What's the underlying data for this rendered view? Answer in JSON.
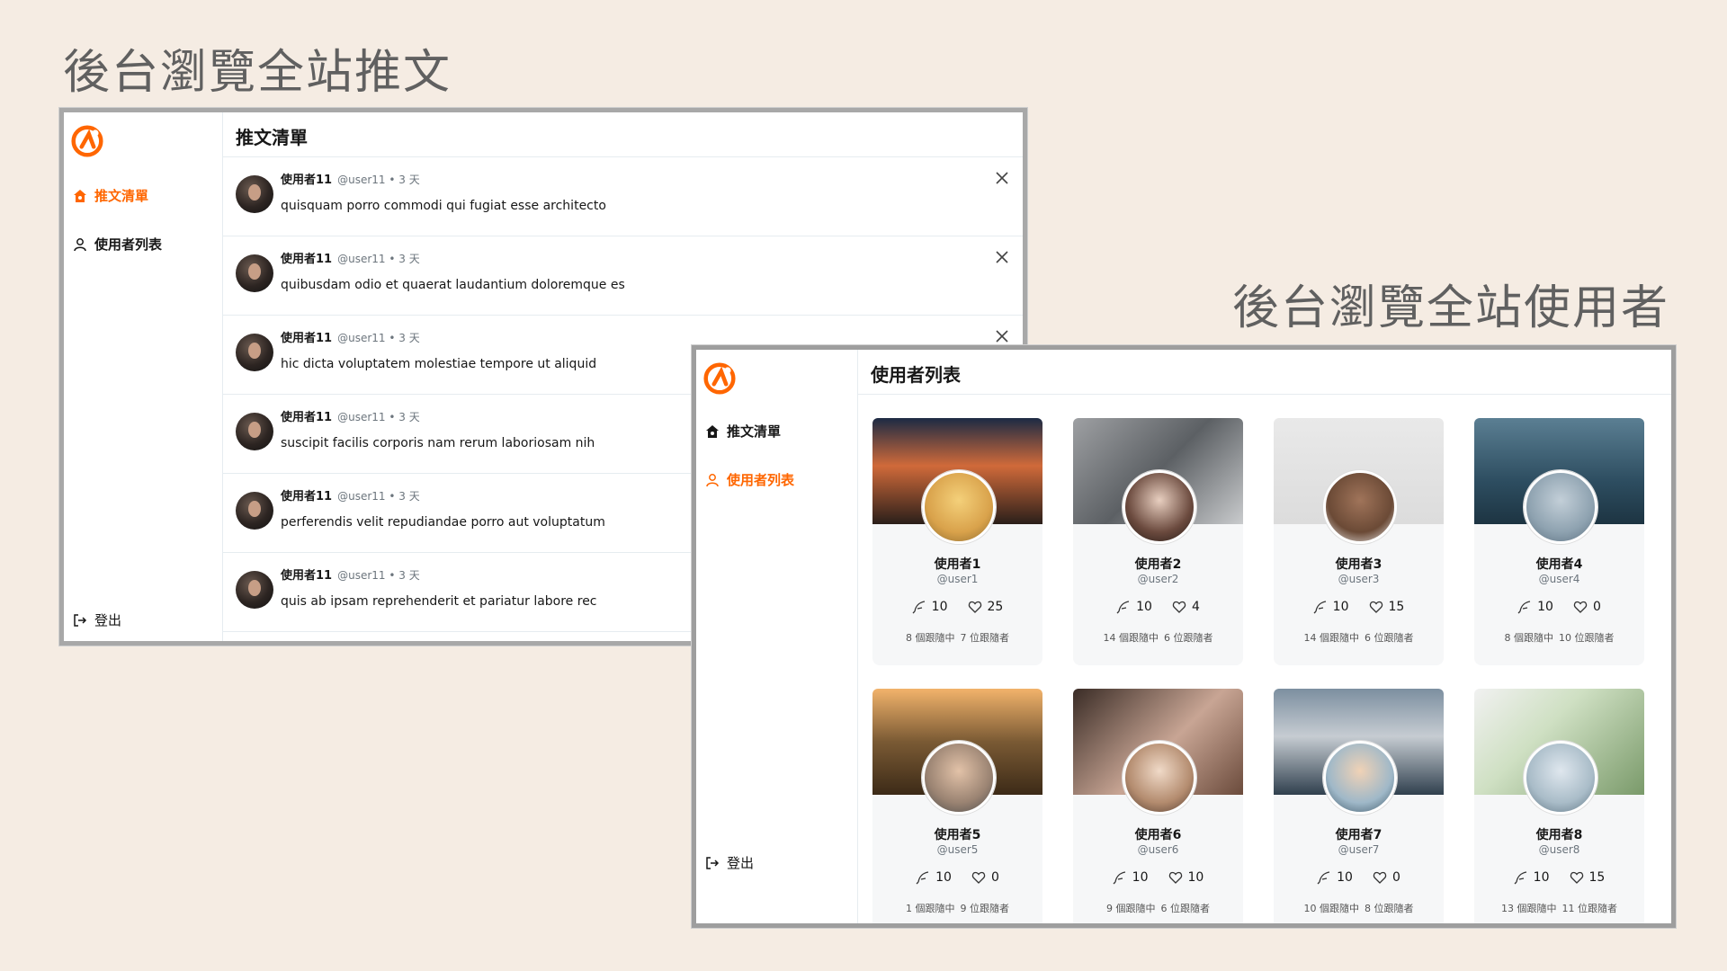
{
  "headings": {
    "tweets_admin": "後台瀏覽全站推文",
    "users_admin": "後台瀏覽全站使用者"
  },
  "colors": {
    "accent": "#ff6600",
    "background": "#f5ece3"
  },
  "nav": {
    "tweets": "推文清單",
    "users": "使用者列表",
    "logout": "登出"
  },
  "tweet_panel": {
    "title": "推文清單",
    "tweets": [
      {
        "name": "使用者11",
        "handle": "@user11",
        "time": "3 天",
        "text": "quisquam porro commodi qui fugiat esse architecto"
      },
      {
        "name": "使用者11",
        "handle": "@user11",
        "time": "3 天",
        "text": "quibusdam odio et quaerat laudantium doloremque es"
      },
      {
        "name": "使用者11",
        "handle": "@user11",
        "time": "3 天",
        "text": "hic dicta voluptatem molestiae tempore ut aliquid"
      },
      {
        "name": "使用者11",
        "handle": "@user11",
        "time": "3 天",
        "text": "suscipit facilis corporis nam rerum laboriosam nih"
      },
      {
        "name": "使用者11",
        "handle": "@user11",
        "time": "3 天",
        "text": "perferendis velit repudiandae porro aut voluptatum"
      },
      {
        "name": "使用者11",
        "handle": "@user11",
        "time": "3 天",
        "text": "quis ab ipsam reprehenderit et pariatur labore rec"
      }
    ]
  },
  "user_panel": {
    "title": "使用者列表",
    "users": [
      {
        "name": "使用者1",
        "handle": "@user1",
        "tweets": "10",
        "likes": "25",
        "following": "8 個跟隨中",
        "followers": "7 位跟隨者"
      },
      {
        "name": "使用者2",
        "handle": "@user2",
        "tweets": "10",
        "likes": "4",
        "following": "14 個跟隨中",
        "followers": "6 位跟隨者"
      },
      {
        "name": "使用者3",
        "handle": "@user3",
        "tweets": "10",
        "likes": "15",
        "following": "14 個跟隨中",
        "followers": "6 位跟隨者"
      },
      {
        "name": "使用者4",
        "handle": "@user4",
        "tweets": "10",
        "likes": "0",
        "following": "8 個跟隨中",
        "followers": "10 位跟隨者"
      },
      {
        "name": "使用者5",
        "handle": "@user5",
        "tweets": "10",
        "likes": "0",
        "following": "1 個跟隨中",
        "followers": "9 位跟隨者"
      },
      {
        "name": "使用者6",
        "handle": "@user6",
        "tweets": "10",
        "likes": "10",
        "following": "9 個跟隨中",
        "followers": "6 位跟隨者"
      },
      {
        "name": "使用者7",
        "handle": "@user7",
        "tweets": "10",
        "likes": "0",
        "following": "10 個跟隨中",
        "followers": "8 位跟隨者"
      },
      {
        "name": "使用者8",
        "handle": "@user8",
        "tweets": "10",
        "likes": "15",
        "following": "13 個跟隨中",
        "followers": "11 位跟隨者"
      }
    ]
  }
}
